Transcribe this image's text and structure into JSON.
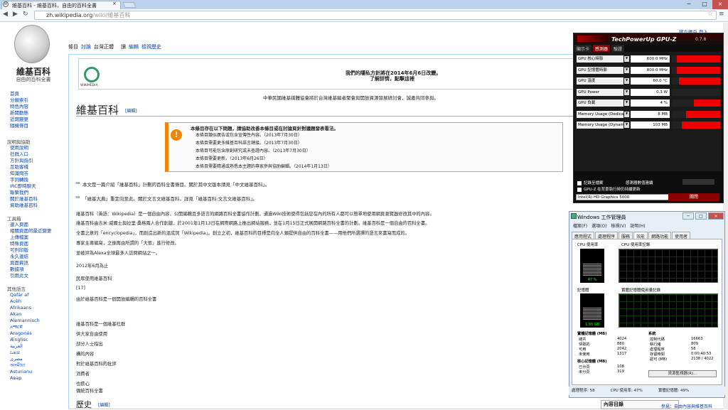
{
  "browser": {
    "tab_title": "維基百科 - 維基百科，自由的百科全書",
    "tab_close": "×",
    "url_host": "zh.wikipedia.org",
    "url_path": "/wiki/維基百科",
    "back": "◀",
    "forward": "▶",
    "reload": "↻",
    "star": "☆",
    "menu": "≡",
    "win_min": "─",
    "win_max": "□",
    "win_close": "×"
  },
  "wiki": {
    "logo_title": "維基百科",
    "logo_sub": "自由的百科全書",
    "sidebar_main": [
      "首頁",
      "分類索引",
      "特色內容",
      "新聞動態",
      "近期變更",
      "隨機條目"
    ],
    "help_head": "說明與協助",
    "sidebar_help": [
      "使用說明",
      "社群入口",
      "方針與指引",
      "互助客棧",
      "知識問答",
      "字詞轉換",
      "IRC即時聊天",
      "聯繫我們",
      "關於維基百科",
      "資助維基百科"
    ],
    "tools_head": "工具箱",
    "sidebar_tools": [
      "連入頁面",
      "相關頁面的最近變更",
      "上傳檔案",
      "特殊頁面",
      "可列印版",
      "永久連結",
      "頁面資訊",
      "數據項",
      "引用此文"
    ],
    "lang_head": "其他語言",
    "langs": [
      "Qafár af",
      "Acèh",
      "Afrikaans",
      "Akan",
      "Alemannisch",
      "አማርኛ",
      "Aragonés",
      "Ænglisc",
      "العربية",
      "ܐܪܡܝܐ",
      "مصرى",
      "অসমীয়া",
      "Asturianu",
      "Авар"
    ],
    "tabs": [
      "條目",
      "討論",
      "台灣正體",
      "讀",
      "編輯",
      "檢視歷史"
    ],
    "user_links": "建立帳戶 登入",
    "notice_line1": "我們的隱私方針將在2014年6月6日改變。",
    "notice_line2": "了解詳情，點擊這裡",
    "wikimedia": "WIKIMEDIA",
    "cn_note": "中華民國維基媒體協會將於台灣維基編者聚會與開放資源發展研討會，誠邀共同參與。",
    "title": "維基百科",
    "edit": "[編輯]",
    "mbox_title": "本條目存在以下問題，請協助改善本條目或在討論頁針對議題發表看法。",
    "mbox_items": [
      "本條目類似廣告或包含宣傳性內容。（2013年7月30日）",
      "本條目需要更多維基百科語言鏈接。（2013年7月30日）",
      "本條目可能包含原創研究或未查證內容。（2013年7月30日）",
      "本條目需要更新。（2013年6月26日）",
      "本條目需要精通或熟悉本主題的專家參與協助編輯。（2014年1月13日）"
    ],
    "hat1": "本文是一篇介紹「維基百科」計劃的百科全書條目。關於其中文版本請見「中文維基百科」。",
    "hat2": "「維基大典」重定向至此。關於文言文維基百科，詳見「維基百科:文言文維基百科」。",
    "body": [
      "維基百科（英語：Wikipedia）是一個自由內容、公開編輯且多語言的網路百科全書協作計劃，通過Wiki技術使得包括您在內的所有人都可以簡單地使用網頁瀏覽器修改其中的內容。",
      "維基百科由吉米·威爾士與拉里·桑格兩人合作創建，於2001年1月13日在網際網路上推出網站服務，並在1月15日正式展開網路百科全書的計劃。維基百科是一個自由的百科全書。",
      "全書之意的「encyclopedia」，而創造出新的混成詞「Wikipedia」。創立之初，維基百科的目標是向全人類提供自由的百科全書——用他們所選擇的語言來書寫而成的。",
      "專家主導編寫，之後再由所謂的「大眾」進行修改。",
      "並被評為Alexa全球最多人訪問網站之一。",
      "2012年6月為止",
      "民眾使用維基百科",
      "[17]",
      "由於維基百科是一個開放編輯的百科全書",
      "維基百科是一個維基社群",
      "供大家自由使用",
      "部分人士指出",
      "構的內容",
      "對於維基百科的批評",
      "消費者",
      "也擔心",
      "傳統百科全書"
    ],
    "h2": "歷史",
    "toc": "內容目錄",
    "tail": "參見：自由內容與維基百科"
  },
  "gpuz": {
    "title": "TechPowerUp GPU-Z",
    "version": "0.7.8",
    "tabs": [
      "顯示卡",
      "感測器",
      "驗證"
    ],
    "rows": [
      {
        "label": "GPU 核心時脈",
        "value": "600.0 MHz",
        "level": 0.9
      },
      {
        "label": "GPU 記憶體時脈",
        "value": "800.0 MHz",
        "level": 0.9
      },
      {
        "label": "GPU 溫度",
        "value": "60.0 °C",
        "level": 0.85
      },
      {
        "label": "GPU Power",
        "value": "0.3 W",
        "level": 0.0
      },
      {
        "label": "GPU 負載",
        "value": "4 %",
        "level": 0.55
      },
      {
        "label": "Memory Usage (Dedicated)",
        "value": "8 MB",
        "level": 0.7
      },
      {
        "label": "Memory Usage (Dynamic)",
        "value": "103 MB",
        "level": 0.8
      }
    ],
    "log": "記錄至檔案",
    "continue": "GPU-Z 在背景執行時仍持續更新",
    "sensor_opt": "感測器數值連續",
    "gpu": "Intel(R) HD Graphics 5000",
    "close": "關閉"
  },
  "taskmgr": {
    "title": "Windows 工作管理員",
    "menu": [
      "檔案(F)",
      "選項(O)",
      "檢視(V)",
      "說明(H)"
    ],
    "tabs": [
      "應用程式",
      "處理程序",
      "服務",
      "效能",
      "網路功能",
      "使用者"
    ],
    "cpu_usage": "CPU 使用率",
    "cpu_history": "CPU 使用率記錄",
    "cpu_pct": "47 %",
    "mem": "記憶體",
    "mem_history": "實體記憶體使用量記錄",
    "mem_val": "1.93 GB",
    "phys_head": "實體記憶體 (MB)",
    "phys": [
      [
        "總共",
        "4024"
      ],
      [
        "快取的",
        "880"
      ],
      [
        "可用",
        "2042"
      ],
      [
        "未使用",
        "1317"
      ]
    ],
    "sys_head": "系統",
    "sys": [
      [
        "控制代碼",
        "16663"
      ],
      [
        "執行緒",
        "809"
      ],
      [
        "處理程序",
        "58"
      ],
      [
        "存留時間",
        "0:00:40:53"
      ],
      [
        "認可 (MB)",
        "2138 / 4022"
      ]
    ],
    "kernel_head": "核心記憶體 (MB)",
    "kernel": [
      [
        "已分頁",
        "108"
      ],
      [
        "未分頁",
        "319"
      ]
    ],
    "res_btn": "資源監視器(R)...",
    "status": [
      "處理程序: 58",
      "CPU 使用率: 47%",
      "實體記憶體: 49%"
    ],
    "cpu_level": 0.47,
    "mem_level": 0.49
  }
}
